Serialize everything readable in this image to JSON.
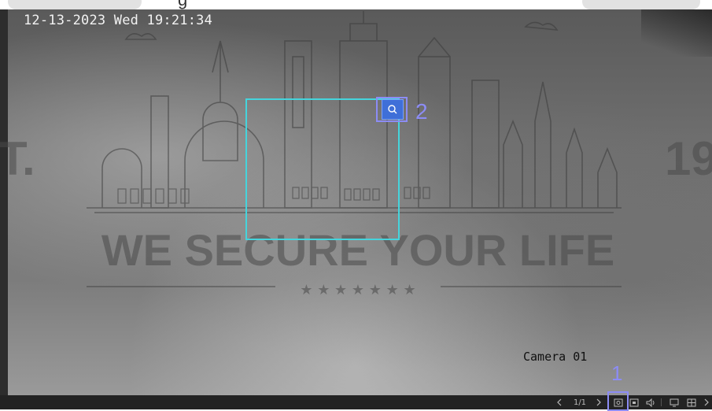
{
  "top_strip": {
    "partial_text": "g"
  },
  "osd": {
    "datetime": "12-13-2023 Wed 19:21:34",
    "camera_name": "Camera 01"
  },
  "watermark": {
    "slogan": "WE SECURE YOUR LIFE",
    "stars": "★ ★ ★ ★ ★ ★ ★",
    "left_fragment": "T.",
    "right_fragment": "19"
  },
  "annotations": {
    "first": "1",
    "second": "2"
  },
  "toolbar": {
    "prev_icon": "chevron-left-icon",
    "page_indicator": "1/1",
    "next_icon": "chevron-right-icon",
    "icons": [
      "digital-zoom-icon",
      "snapshot-icon",
      "audio-icon",
      "window-icon",
      "layout-icon"
    ]
  },
  "colors": {
    "detection_box": "#45d4dc",
    "annotation": "#8c8cf5",
    "zoom_button": "#3f6fd8",
    "toolbar_bg": "#232323"
  }
}
